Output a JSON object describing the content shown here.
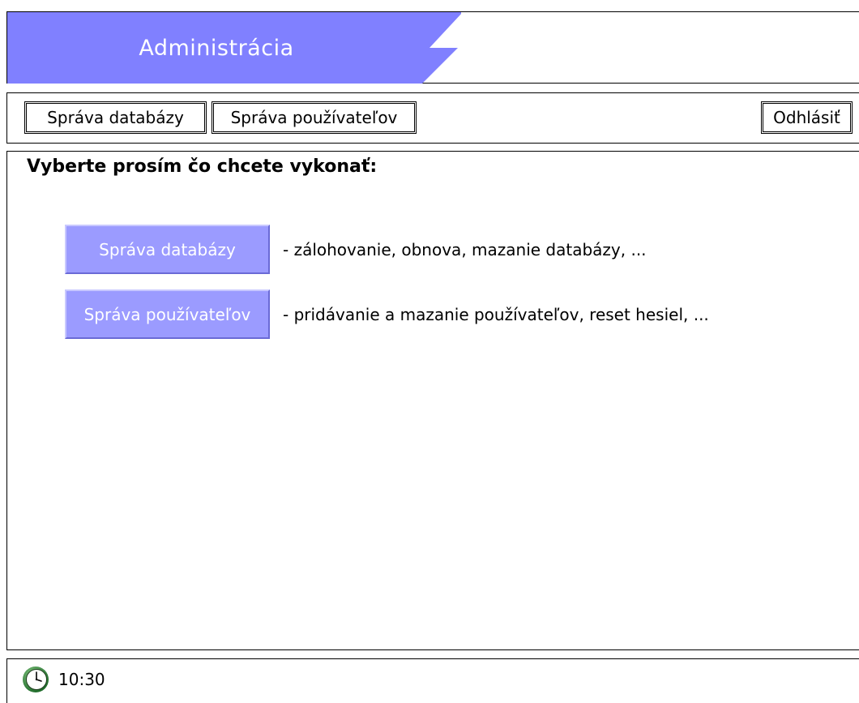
{
  "header": {
    "title": "Administrácia"
  },
  "nav": {
    "db_label": "Správa databázy",
    "users_label": "Správa používateľov",
    "logout_label": "Odhlásiť"
  },
  "main": {
    "prompt": "Vyberte prosím čo chcete vykonať:",
    "actions": [
      {
        "label": "Správa databázy",
        "description": "- zálohovanie, obnova, mazanie databázy, ..."
      },
      {
        "label": "Správa používateľov",
        "description": "- pridávanie a mazanie používateľov, reset hesiel, ..."
      }
    ]
  },
  "footer": {
    "time": "10:30",
    "icon": "clock-icon"
  },
  "colors": {
    "banner": "#8080ff",
    "action_button": "#9b9bff",
    "action_text": "#ffffff"
  }
}
